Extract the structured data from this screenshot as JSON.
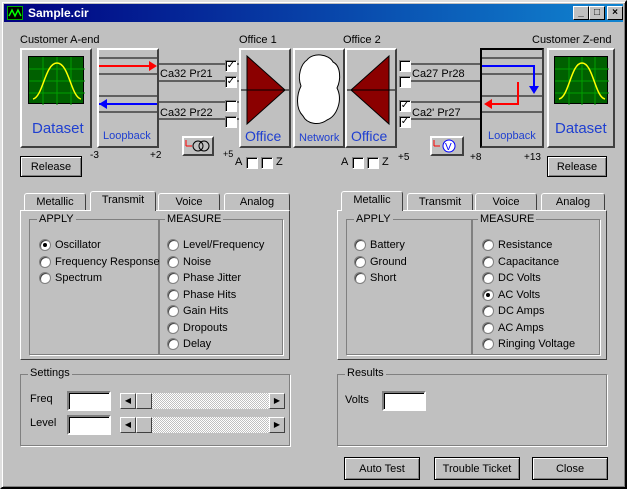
{
  "window": {
    "title": "Sample.cir"
  },
  "circuit": {
    "customer_a_label": "Customer A-end",
    "customer_z_label": "Customer Z-end",
    "office1_label": "Office 1",
    "office2_label": "Office 2",
    "dataset_label": "Dataset",
    "loopback_label": "Loopback",
    "office_label": "Office",
    "network_label": "Network",
    "pairs_left": [
      "Ca32 Pr21",
      "Ca32 Pr22"
    ],
    "pairs_right": [
      "Ca27 Pr28",
      "Ca2' Pr27"
    ],
    "level_a_left": "-3",
    "level_a_right": "+2",
    "level_office1": "+5",
    "level_office2": "+5",
    "level_z_left": "+8",
    "level_z_right": "+13",
    "az_a": "A",
    "az_z": "Z",
    "release_label": "Release"
  },
  "left_tabs": {
    "tabs": [
      "Metallic",
      "Transmit",
      "Voice",
      "Analog"
    ],
    "active": "Transmit",
    "apply_title": "APPLY",
    "apply_options": [
      "Oscillator",
      "Frequency Response",
      "Spectrum"
    ],
    "apply_selected": "Oscillator",
    "measure_title": "MEASURE",
    "measure_options": [
      "Level/Frequency",
      "Noise",
      "Phase Jitter",
      "Phase Hits",
      "Gain Hits",
      "Dropouts",
      "Delay"
    ]
  },
  "right_tabs": {
    "tabs": [
      "Metallic",
      "Transmit",
      "Voice",
      "Analog"
    ],
    "active": "Metallic",
    "apply_title": "APPLY",
    "apply_options": [
      "Battery",
      "Ground",
      "Short"
    ],
    "measure_title": "MEASURE",
    "measure_options": [
      "Resistance",
      "Capacitance",
      "DC Volts",
      "AC Volts",
      "DC Amps",
      "AC Amps",
      "Ringing Voltage"
    ],
    "measure_selected": "AC Volts"
  },
  "settings": {
    "title": "Settings",
    "freq_label": "Freq",
    "level_label": "Level",
    "freq_value": "",
    "level_value": ""
  },
  "results": {
    "title": "Results",
    "volts_label": "Volts",
    "volts_value": ""
  },
  "buttons": {
    "auto_test": "Auto Test",
    "trouble_ticket": "Trouble Ticket",
    "close": "Close"
  },
  "colors": {
    "office": "#8b0000",
    "scope_bg": "#006000",
    "scope_trace": "#ffff00",
    "signal_red": "#ff0000",
    "signal_blue": "#0000ff",
    "label_blue": "#1f3fd0"
  }
}
